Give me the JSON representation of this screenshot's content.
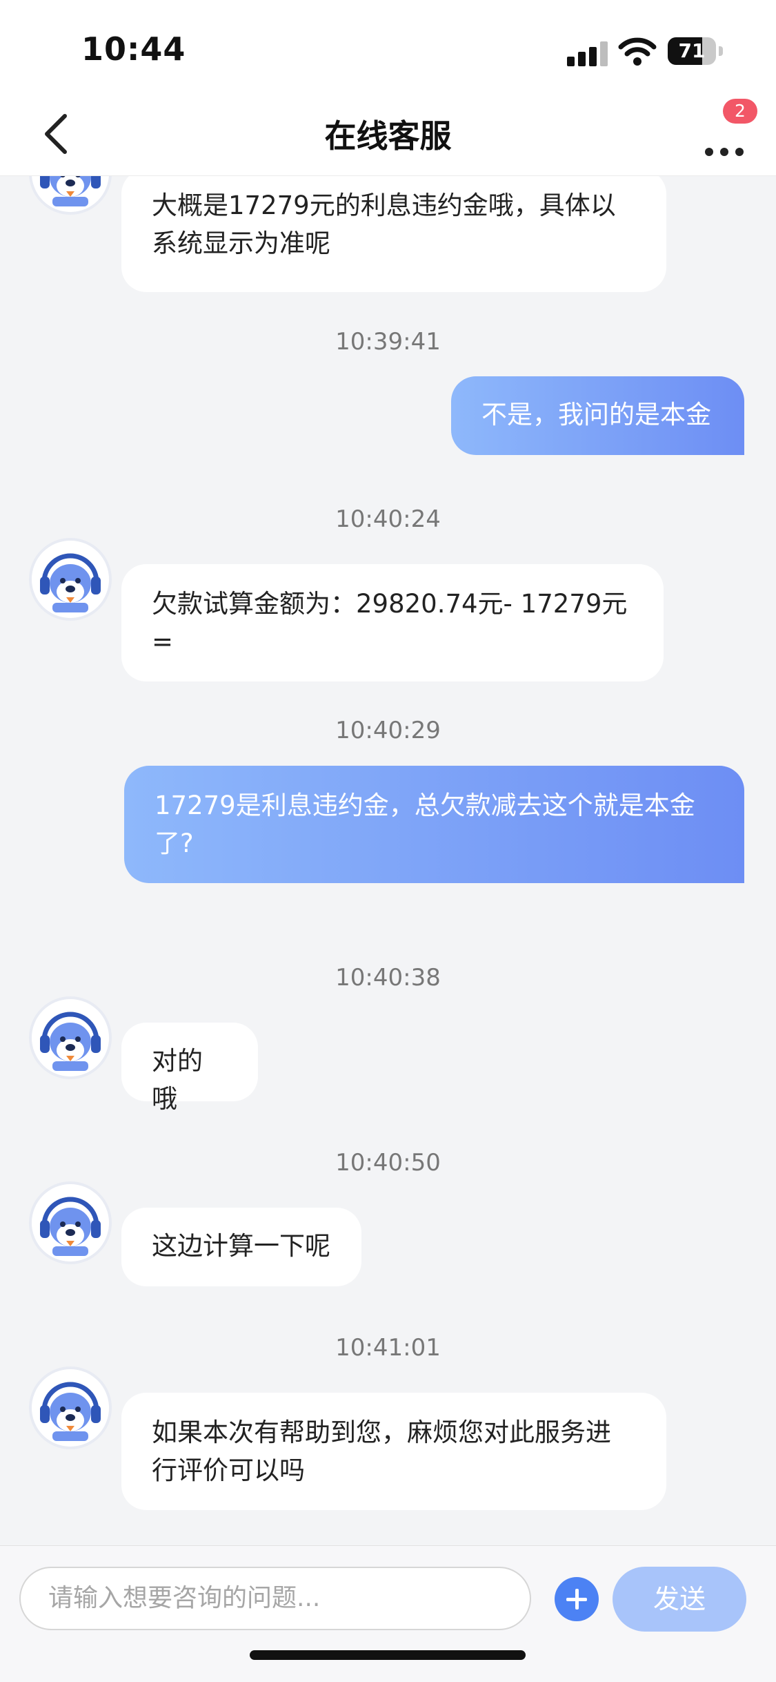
{
  "status_bar": {
    "time": "10:44",
    "battery": "71",
    "battery_level": 0.71
  },
  "nav": {
    "title": "在线客服",
    "badge": "2"
  },
  "messages": [
    {
      "from": "agent",
      "text": "大概是17279元的利息违约金哦，具体以系统显示为准呢"
    },
    {
      "time": "10:39:41",
      "from": "user",
      "text": "不是，我问的是本金"
    },
    {
      "time": "10:40:24",
      "from": "agent",
      "text": "欠款试算金额为：29820.74元- 17279元="
    },
    {
      "time": "10:40:29",
      "from": "user",
      "text": "17279是利息违约金，总欠款减去这个就是本金了?"
    },
    {
      "time": "10:40:38",
      "from": "agent",
      "text": "对的哦"
    },
    {
      "time": "10:40:50",
      "from": "agent",
      "text": "这边计算一下呢"
    },
    {
      "time": "10:41:01",
      "from": "agent",
      "text": "如果本次有帮助到您，麻烦您对此服务进行评价可以吗"
    }
  ],
  "input": {
    "placeholder": "请输入想要咨询的问题..."
  },
  "send_label": "发送",
  "icons": {
    "back": "chevron-left-icon",
    "more": "more-dots-icon",
    "plus": "plus-icon",
    "avatar": "agent-mascot-avatar"
  },
  "colors": {
    "accent": "#4c82f4",
    "bubble_gradient_start": "#8eb8fb",
    "bubble_gradient_end": "#6d8ef4",
    "badge": "#f25767",
    "send_disabled": "#a8c4fa"
  }
}
